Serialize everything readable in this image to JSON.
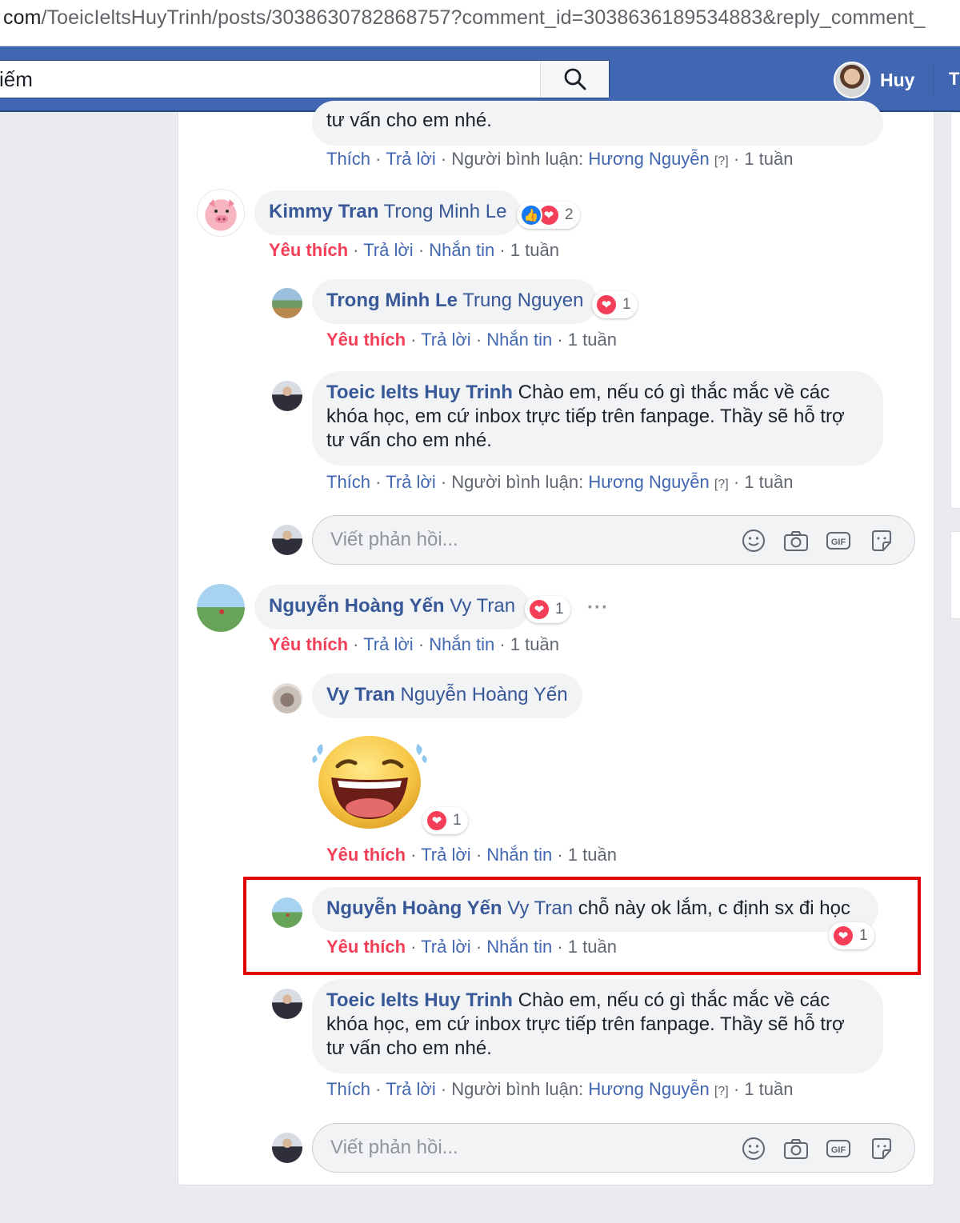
{
  "browser": {
    "url_host": "com",
    "url_path": "/ToeicIeltsHuyTrinh/posts/3038630782868757?comment_id=3038636189534883&reply_comment_"
  },
  "header": {
    "search_value": "iếm",
    "profile_name": "Huy",
    "next_item": "T",
    "colors": {
      "bar": "#4267b2",
      "love": "#f33e58",
      "link": "#385898"
    }
  },
  "actions": {
    "like": "Thích",
    "loved": "Yêu thích",
    "reply": "Trả lời",
    "message": "Nhắn tin",
    "commenter_prefix": "Người bình luận:",
    "commenter_name": "Hương Nguyễn",
    "help": "[?]",
    "sep": "·",
    "time": "1 tuần"
  },
  "reply_placeholder": "Viết phản hồi...",
  "comments": [
    {
      "author": "",
      "mention": "",
      "text_tail": "tư vấn cho em nhé."
    },
    {
      "author": "Kimmy Tran",
      "mention": "Trong Minh Le",
      "reactions": "2"
    },
    {
      "author": "Trong Minh Le",
      "mention": "Trung Nguyen",
      "reactions": "1"
    },
    {
      "author": "Toeic Ielts Huy Trinh",
      "text_line1": "Chào em, nếu có gì thắc mắc về các",
      "text_line2": "khóa học, em cứ inbox trực tiếp trên fanpage. Thầy sẽ hỗ trợ",
      "text_line3": "tư vấn cho em nhé."
    },
    {
      "author": "Nguyễn Hoàng Yến",
      "mention": "Vy Tran",
      "reactions": "1",
      "more": "···"
    },
    {
      "author": "Vy Tran",
      "mention": "Nguyễn Hoàng Yến",
      "sticker": "laughing-tears-face",
      "reactions": "1"
    },
    {
      "author": "Nguyễn Hoàng Yến",
      "mention": "Vy Tran",
      "text": "chỗ này ok lắm, c định sx đi học",
      "reactions": "1"
    },
    {
      "author": "Toeic Ielts Huy Trinh",
      "text_line1": "Chào em, nếu có gì thắc mắc về các",
      "text_line2": "khóa học, em cứ inbox trực tiếp trên fanpage. Thầy sẽ hỗ trợ",
      "text_line3": "tư vấn cho em nhé."
    }
  ]
}
